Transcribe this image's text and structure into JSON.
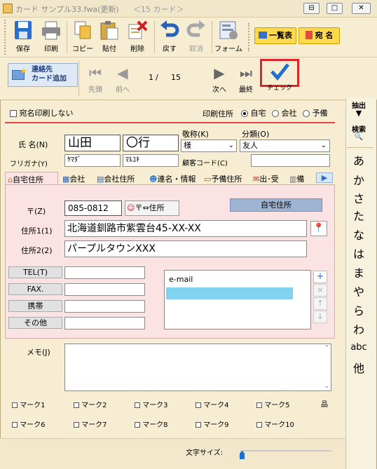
{
  "window": {
    "title": "カード サンプル33.fwa(更新)",
    "subtitle": "＜15 カード＞"
  },
  "window_buttons": [
    "⊟",
    "□",
    "✕"
  ],
  "toolbar": {
    "save": "保存",
    "print": "印刷",
    "copy": "コピー",
    "paste": "貼付",
    "delete": "削除",
    "undo": "戻す",
    "redo": "取消",
    "form": "フォーム",
    "list": "一覧表",
    "address": "宛 名"
  },
  "nav": {
    "add_contact": "連絡先\nカード追加",
    "first": "先頭",
    "prev": "前へ",
    "next": "次へ",
    "last": "最終",
    "check": "チェック",
    "current": "1",
    "separator": "/",
    "total": "15"
  },
  "side": {
    "extract": "抽出",
    "search": "検索",
    "kana": [
      "あ",
      "か",
      "さ",
      "た",
      "な",
      "は",
      "ま",
      "や",
      "ら",
      "わ"
    ],
    "abc": "abc",
    "other": "他"
  },
  "form": {
    "no_print_label": "宛名印刷しない",
    "print_addr_label": "印刷住所",
    "print_addr_options": [
      "自宅",
      "会社",
      "予備"
    ],
    "name_label": "氏 名(N)",
    "last_name": "山田",
    "first_name": "〇行",
    "kana_label": "フリガナ(Y)",
    "last_kana": "ﾔﾏﾀﾞ",
    "first_kana": "ﾏﾙﾕｷ",
    "honorific_label": "敬称(K)",
    "honorific": "様",
    "category_label": "分類(O)",
    "category": "友人",
    "customer_code_label": "顧客コード(C)",
    "customer_code": ""
  },
  "tabs": [
    "自宅住所",
    "会社",
    "会社住所",
    "連名・情報",
    "予備住所",
    "出･受",
    "備"
  ],
  "home": {
    "zip_label": "〒(Z)",
    "zip": "085-0812",
    "zip_button": "〒⇔住所",
    "section_label": "自宅住所",
    "addr1_label": "住所1(1)",
    "addr1": "北海道釧路市紫雲台45-XX-XX",
    "addr2_label": "住所2(2)",
    "addr2": "パープルタウンXXX",
    "tel_label": "TEL(T)",
    "fax_label": "FAX.",
    "mobile_label": "携帯",
    "other_label": "その他",
    "email_header": "e-mail",
    "list_buttons": [
      "+",
      "×",
      "↑",
      "↓"
    ]
  },
  "memo": {
    "label": "メモ(J)"
  },
  "marks": [
    "マーク1",
    "マーク2",
    "マーク3",
    "マーク4",
    "マーク5",
    "マーク6",
    "マーク7",
    "マーク8",
    "マーク9",
    "マーク10"
  ],
  "marks_icon": "品",
  "footer": {
    "font_size_label": "文字サイズ:"
  },
  "colors": {
    "accent_red": "#e0252a",
    "check_blue": "#1f6fd1",
    "yellow": "#ffd94d",
    "pink": "#fbe3e4",
    "selected_row": "#7fd3f0"
  }
}
